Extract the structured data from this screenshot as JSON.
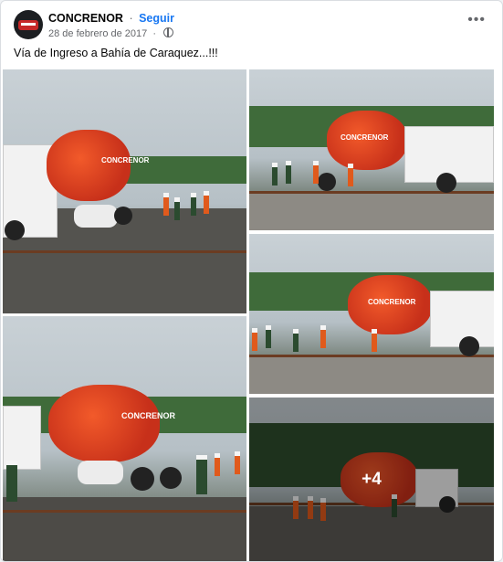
{
  "post": {
    "page_name": "CONCRENOR",
    "follow_label": "Seguir",
    "separator": "·",
    "date": "28 de febrero de 2017",
    "more_label": "•••",
    "caption": "Vía de Ingreso a Bahía de Caraquez...!!!"
  },
  "photos": {
    "drum_text": "CONCRENOR",
    "more_count": "+4"
  }
}
